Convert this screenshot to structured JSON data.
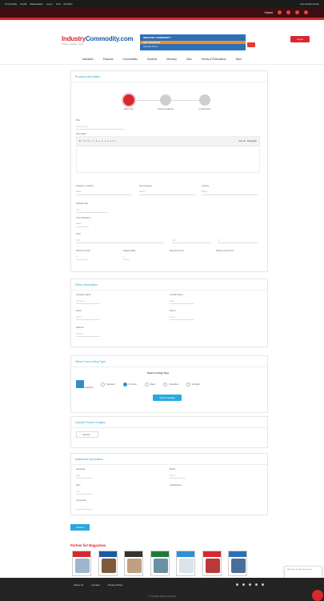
{
  "topbar": {
    "browser_items": [
      "Commodity",
      "Social",
      "Marketplace",
      "Log in",
      "Cart",
      "Portfolio"
    ],
    "right_label": "Commodity Group",
    "nav_items": [
      "Submit",
      "Tips",
      "Tools"
    ]
  },
  "header": {
    "logo_left": "Industry",
    "logo_right": "Commodity.com",
    "logo_sub": "Industry · Markets · News",
    "banner_line1": "INDUSTRY COMMODITY",
    "banner_line2": "GET STARTED",
    "banner_line3": "Advertise with us",
    "login_label": "Log In"
  },
  "mainnav": [
    "Industries",
    "Products",
    "Commodities",
    "Services",
    "Directory",
    "Jobs",
    "Events & Publications",
    "Store"
  ],
  "form": {
    "section1_title": "Product Information",
    "steps": [
      {
        "label": "Basic Info",
        "active": true
      },
      {
        "label": "Product Features",
        "active": false
      },
      {
        "label": "Confirmation",
        "active": false
      }
    ],
    "title_label": "Title",
    "title_placeholder": "Product name",
    "description_label": "Description",
    "editor_buttons": [
      "B",
      "I",
      "U",
      "S",
      "x",
      "x",
      "A",
      "≡",
      "≡",
      "≡",
      "≡",
      "≡",
      "¶",
      "⋯"
    ],
    "editor_right": [
      "Format",
      "Paragraph"
    ],
    "row1": [
      {
        "label": "Category / Industry",
        "placeholder": "Select..."
      },
      {
        "label": "Sub-Category",
        "placeholder": "Select..."
      },
      {
        "label": "Country",
        "placeholder": "Select..."
      }
    ],
    "website_label": "Website URL",
    "website_placeholder": "http://",
    "units_label": "Unit of Measure",
    "units_value": "Select",
    "price_label": "Price",
    "price_value": "0.00",
    "price_from": "From",
    "price_to": "To",
    "row4": [
      {
        "label": "Minimum Order",
        "value": "0"
      },
      {
        "label": "Supply Ability",
        "value": "0"
      },
      {
        "label": "Payment Terms",
        "value": ""
      },
      {
        "label": "Delivery Lead Time",
        "value": ""
      }
    ],
    "section2_title": "Seller Information",
    "seller_fields": [
      {
        "label": "Company Name",
        "placeholder": "Company"
      },
      {
        "label": "Contact Name",
        "placeholder": "Name"
      },
      {
        "label": "Email",
        "placeholder": "Email"
      },
      {
        "label": "Phone",
        "placeholder": "Phone"
      },
      {
        "label": "Address",
        "placeholder": "Address"
      }
    ],
    "section3_title": "Select Your Listing Type",
    "listing_heading": "Select Listing Type",
    "listing_options": [
      "Featured",
      "Standard",
      "Premium",
      "Basic",
      "Classified",
      "Spotlight"
    ],
    "listing_button": "Select Package",
    "section4_title": "Upload Product Images",
    "upload_button": "Browse...",
    "section5_title": "Additional Information",
    "extra_fields": [
      {
        "label": "Keywords",
        "placeholder": "Tags"
      },
      {
        "label": "Brand",
        "placeholder": "Brand"
      },
      {
        "label": "SKU",
        "placeholder": "SKU"
      },
      {
        "label": "Certifications",
        "placeholder": ""
      },
      {
        "label": "Comments",
        "placeholder": ""
      }
    ],
    "submit_label": "Submit"
  },
  "magazines": {
    "title": "Partner list Magazines",
    "covers": [
      {
        "stripe": "#d7282f",
        "photo": "#9fb5cf"
      },
      {
        "stripe": "#1b5aa6",
        "photo": "#7d5a3c"
      },
      {
        "stripe": "#333333",
        "photo": "#c0a080"
      },
      {
        "stripe": "#1e7a3a",
        "photo": "#6b8fa3"
      },
      {
        "stripe": "#2d8fd5",
        "photo": "#d9e3ea"
      },
      {
        "stripe": "#d7282f",
        "photo": "#b93a3a"
      },
      {
        "stripe": "#2d70b7",
        "photo": "#4a6e9a"
      }
    ]
  },
  "chat_popup": "We're here to help! Chat with us",
  "footer": {
    "links": [
      "About Us",
      "Contact",
      "Privacy Policy"
    ],
    "copyright": "© Copyright Industry Commodity"
  }
}
